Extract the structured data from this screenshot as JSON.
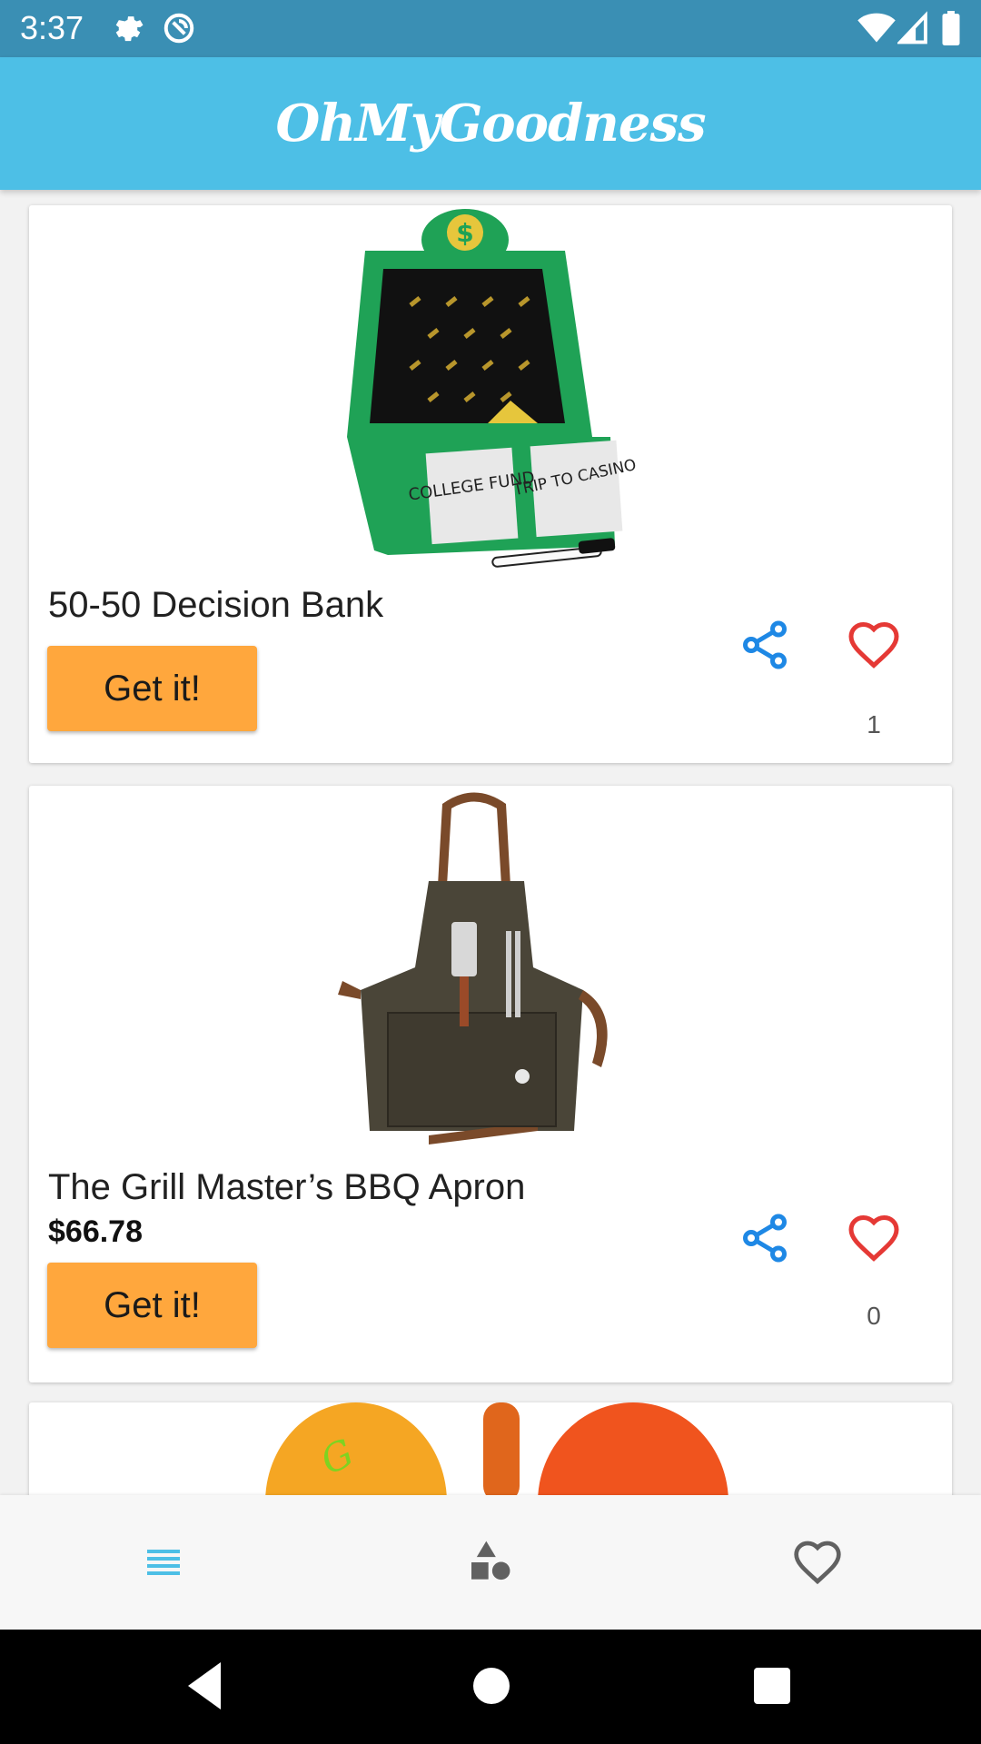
{
  "status_bar": {
    "time": "3:37",
    "icons": [
      "settings-icon",
      "sync-icon",
      "wifi-icon",
      "signal-icon",
      "battery-icon"
    ]
  },
  "app_bar": {
    "title": "OhMyGoodness"
  },
  "products": [
    {
      "name": "50-50 Decision Bank",
      "price": "",
      "button_label": "Get it!",
      "like_count": "1",
      "image_labels": [
        "COLLEGE FUND",
        "TRIP TO CASINO"
      ]
    },
    {
      "name": "The Grill Master’s BBQ Apron",
      "price": "$66.78",
      "button_label": "Get it!",
      "like_count": "0"
    }
  ],
  "bottom_nav": {
    "items": [
      {
        "icon": "list-icon",
        "active": true
      },
      {
        "icon": "categories-icon",
        "active": false
      },
      {
        "icon": "heart-icon",
        "active": false
      }
    ]
  },
  "colors": {
    "status_bar": "#3a8fb4",
    "app_bar": "#4dbfe6",
    "button": "#ffa73d",
    "share": "#1e88e5",
    "like": "#e53935",
    "nav_active": "#4dbfe6"
  }
}
